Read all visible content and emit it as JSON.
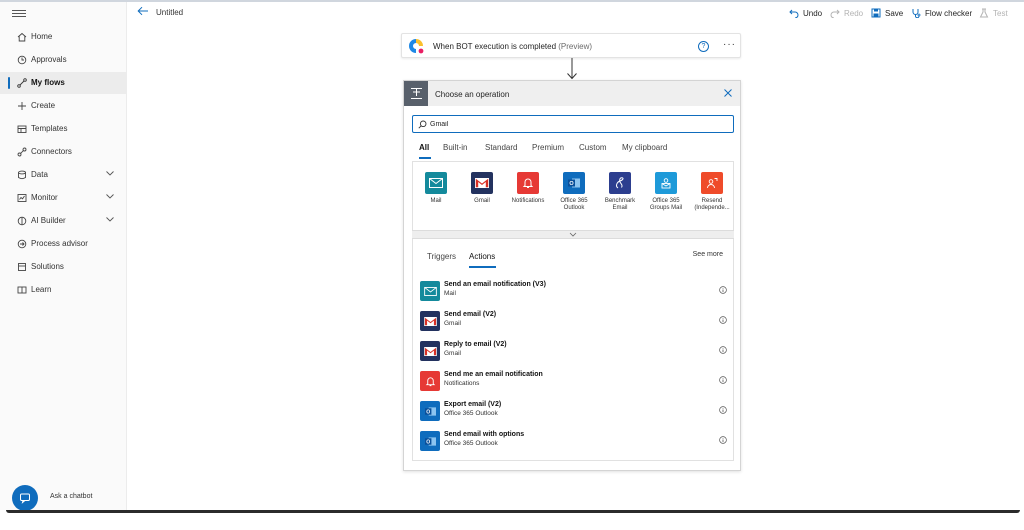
{
  "app": {
    "flow_title": "Untitled",
    "chatbot_label": "Ask a chatbot"
  },
  "sidebar": {
    "items": [
      {
        "label": "Home",
        "icon": "home-icon"
      },
      {
        "label": "Approvals",
        "icon": "approvals-icon"
      },
      {
        "label": "My flows",
        "icon": "flows-icon",
        "active": true
      },
      {
        "label": "Create",
        "icon": "plus-icon"
      },
      {
        "label": "Templates",
        "icon": "templates-icon"
      },
      {
        "label": "Connectors",
        "icon": "connectors-icon"
      },
      {
        "label": "Data",
        "icon": "data-icon",
        "expandable": true
      },
      {
        "label": "Monitor",
        "icon": "monitor-icon",
        "expandable": true
      },
      {
        "label": "AI Builder",
        "icon": "ai-builder-icon",
        "expandable": true
      },
      {
        "label": "Process advisor",
        "icon": "process-advisor-icon"
      },
      {
        "label": "Solutions",
        "icon": "solutions-icon"
      },
      {
        "label": "Learn",
        "icon": "learn-icon"
      }
    ]
  },
  "toolbar": {
    "undo": "Undo",
    "redo": "Redo",
    "save": "Save",
    "flow_checker": "Flow checker",
    "test": "Test"
  },
  "trigger": {
    "label": "When BOT execution is completed",
    "suffix": "(Preview)"
  },
  "operation_panel": {
    "title": "Choose an operation",
    "search_value": "Gmail",
    "tabs": [
      "All",
      "Built-in",
      "Standard",
      "Premium",
      "Custom",
      "My clipboard"
    ],
    "connectors": [
      {
        "name": "Mail",
        "icon": "mail-icon",
        "color": "#148a9c"
      },
      {
        "name": "Gmail",
        "icon": "gmail-icon",
        "color": "#23325f"
      },
      {
        "name": "Notifications",
        "icon": "bell-icon",
        "color": "#e63935"
      },
      {
        "name": "Office 365 Outlook",
        "icon": "outlook-icon",
        "color": "#0f6cbd"
      },
      {
        "name": "Benchmark Email",
        "icon": "benchmark-icon",
        "color": "#2c3e8f"
      },
      {
        "name": "Office 365 Groups Mail",
        "icon": "groups-mail-icon",
        "color": "#1e9ad9"
      },
      {
        "name": "Resend (Independe...",
        "icon": "resend-icon",
        "color": "#ef4b2a"
      }
    ],
    "sub_tabs": [
      "Triggers",
      "Actions"
    ],
    "see_more": "See more",
    "actions": [
      {
        "name": "Send an email notification (V3)",
        "connector": "Mail",
        "icon": "mail-icon",
        "color": "#148a9c"
      },
      {
        "name": "Send email (V2)",
        "connector": "Gmail",
        "icon": "gmail-icon",
        "color": "#23325f"
      },
      {
        "name": "Reply to email (V2)",
        "connector": "Gmail",
        "icon": "gmail-icon",
        "color": "#23325f"
      },
      {
        "name": "Send me an email notification",
        "connector": "Notifications",
        "icon": "bell-icon",
        "color": "#e63935"
      },
      {
        "name": "Export email (V2)",
        "connector": "Office 365 Outlook",
        "icon": "outlook-icon",
        "color": "#0f6cbd"
      },
      {
        "name": "Send email with options",
        "connector": "Office 365 Outlook",
        "icon": "outlook-icon",
        "color": "#0f6cbd"
      }
    ]
  }
}
